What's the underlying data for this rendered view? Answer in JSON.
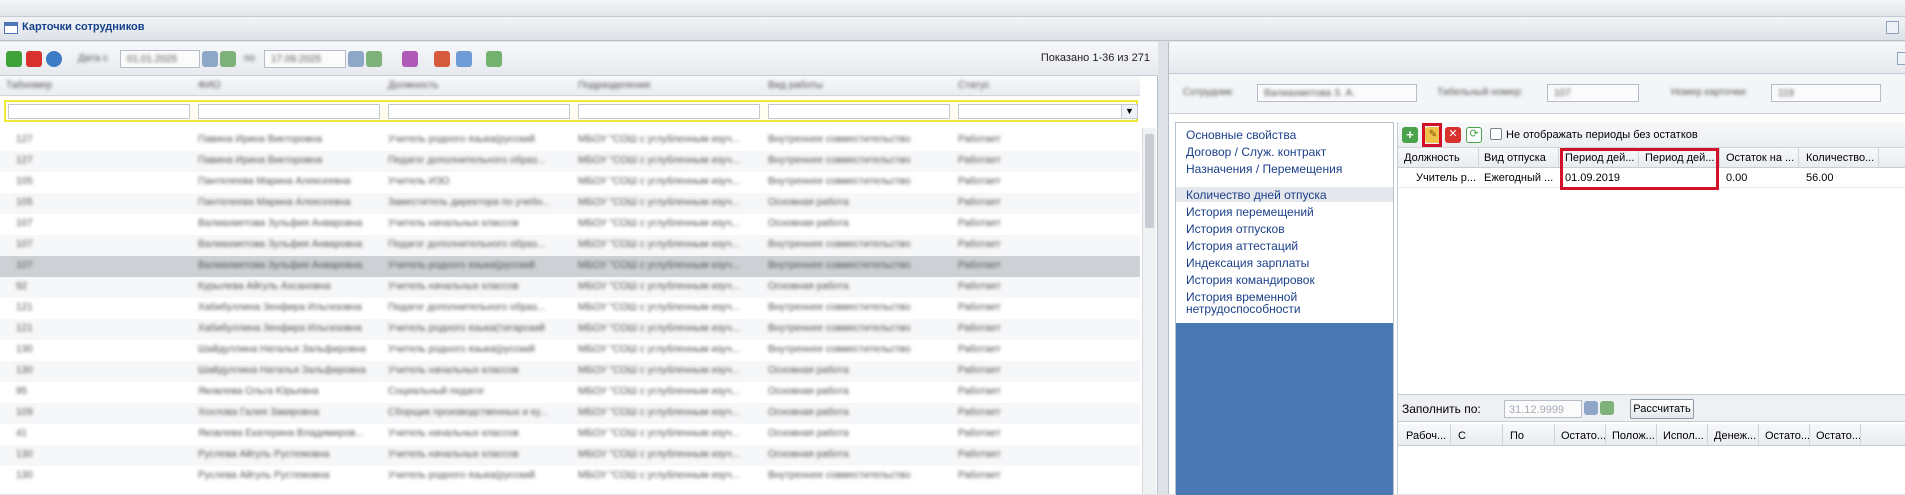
{
  "window": {
    "title": "Карточки сотрудников"
  },
  "left": {
    "toolbar": {
      "date_from_label": "Дата с",
      "date_from": "01.01.2025",
      "date_to_label": "по",
      "date_to": "17.09.2025"
    },
    "shown_text": "Показано 1-36 из 271",
    "columns": [
      "Табномер",
      "ФИО",
      "Должность",
      "Подразделение",
      "Вид работы",
      "Статус"
    ],
    "rows": [
      [
        "127",
        "Павина Ирина Викторовна",
        "Учитель родного языка(русский",
        "МБОУ \"СОШ с углубленным изуч...",
        "Внутреннее совместительство",
        "Работает"
      ],
      [
        "127",
        "Павина Ирина Викторовна",
        "Педагог дополнительного образ...",
        "МБОУ \"СОШ с углубленным изуч...",
        "Внутреннее совместительство",
        "Работает"
      ],
      [
        "105",
        "Пантелеева Марина Алексеевна",
        "Учитель ИЗО",
        "МБОУ \"СОШ с углубленным изуч...",
        "Внутреннее совместительство",
        "Работает"
      ],
      [
        "105",
        "Пантелеева Марина Алексеевна",
        "Заместитель директора по учебн...",
        "МБОУ \"СОШ с углубленным изуч...",
        "Основная работа",
        "Работает"
      ],
      [
        "107",
        "Валиахметова Зульфия Анваровна",
        "Учитель начальных классов",
        "МБОУ \"СОШ с углубленным изуч...",
        "Основная работа",
        "Работает"
      ],
      [
        "107",
        "Валиахметова Зульфия Анваровна",
        "Педагог дополнительного образ...",
        "МБОУ \"СОШ с углубленным изуч...",
        "Внутреннее совместительство",
        "Работает"
      ],
      [
        "107",
        "Валиахметова Зульфия Анваровна",
        "Учитель родного языка(русский",
        "МБОУ \"СОШ с углубленным изуч...",
        "Внутреннее совместительство",
        "Работает"
      ],
      [
        "92",
        "Курылева Айгуль Ахсановна",
        "Учитель начальных классов",
        "МБОУ \"СОШ с углубленным изуч...",
        "Основная работа",
        "Работает"
      ],
      [
        "121",
        "Хабибуллина Зенфира Ильгизовна",
        "Педагог дополнительного образ...",
        "МБОУ \"СОШ с углубленным изуч...",
        "Внутреннее совместительство",
        "Работает"
      ],
      [
        "121",
        "Хабибуллина Зенфира Ильгизовна",
        "Учитель родного языка(татарский",
        "МБОУ \"СОШ с углубленным изуч...",
        "Внутреннее совместительство",
        "Работает"
      ],
      [
        "130",
        "Шайдуллина Наталья Зальфировна",
        "Учитель родного языка(русский",
        "МБОУ \"СОШ с углубленным изуч...",
        "Внутреннее совместительство",
        "Работает"
      ],
      [
        "130",
        "Шайдуллина Наталья Зальфировна",
        "Учитель начальных классов",
        "МБОУ \"СОШ с углубленным изуч...",
        "Основная работа",
        "Работает"
      ],
      [
        "95",
        "Яковлева Ольга Юрьевна",
        "Социальный педагог",
        "МБОУ \"СОШ с углубленным изуч...",
        "Основная работа",
        "Работает"
      ],
      [
        "109",
        "Хохлова Галия Закировна",
        "Сборщик производственных и ку...",
        "МБОУ \"СОШ с углубленным изуч...",
        "Основная работа",
        "Работает"
      ],
      [
        "41",
        "Яковлева Екатерина Владимиров...",
        "Учитель начальных классов",
        "МБОУ \"СОШ с углубленным изуч...",
        "Основная работа",
        "Работает"
      ],
      [
        "130",
        "Руслева Айгуль Рустемовна",
        "Учитель начальных классов",
        "МБОУ \"СОШ с углубленным изуч...",
        "Основная работа",
        "Работает"
      ],
      [
        "130",
        "Руслева Айгуль Рустемовна",
        "Учитель родного языка(русский",
        "МБОУ \"СОШ с углубленным изуч...",
        "Внутреннее совместительство",
        "Работает"
      ],
      [
        "277",
        "Исмагилова Ильсияр Самиголовна",
        "Педагог дополнительного образо...",
        "МБОУ \"СОШ с углубленным изуч...",
        "Внутреннее совместительство",
        "Работает"
      ]
    ],
    "selected_row": 6
  },
  "right": {
    "info": {
      "employee_label": "Сотрудник:",
      "employee_value": "Валиахметова З. А.",
      "tab_label": "Табельный номер:",
      "tab_value": "107",
      "card_label": "Номер карточки:",
      "card_value": "119"
    },
    "nav": [
      "Основные свойства",
      "Договор / Служ. контракт",
      "Назначения / Перемещения",
      "Количество дней отпуска",
      "История перемещений",
      "История отпусков",
      "История аттестаций",
      "Индексация зарплаты",
      "История командировок",
      "История временной нетрудоспособности"
    ],
    "nav_selected": 3,
    "checkbox_label": "Не отображать периоды без остатков",
    "grid_columns": [
      "Должность",
      "Вид отпуска",
      "Период дей...",
      "Период дей...",
      "Остаток на ...",
      "Количество..."
    ],
    "grid_row": [
      "Учитель р...",
      "Ежегодный ...",
      "01.09.2019",
      "",
      "0.00",
      "56.00"
    ],
    "fill_label": "Заполнить по:",
    "fill_date": "31.12.9999",
    "calc_button": "Рассчитать",
    "bottom_columns": [
      "Рабоч...",
      "С",
      "По",
      "Остато...",
      "Полож...",
      "Испол...",
      "Денеж...",
      "Остато...",
      "Остато..."
    ]
  }
}
